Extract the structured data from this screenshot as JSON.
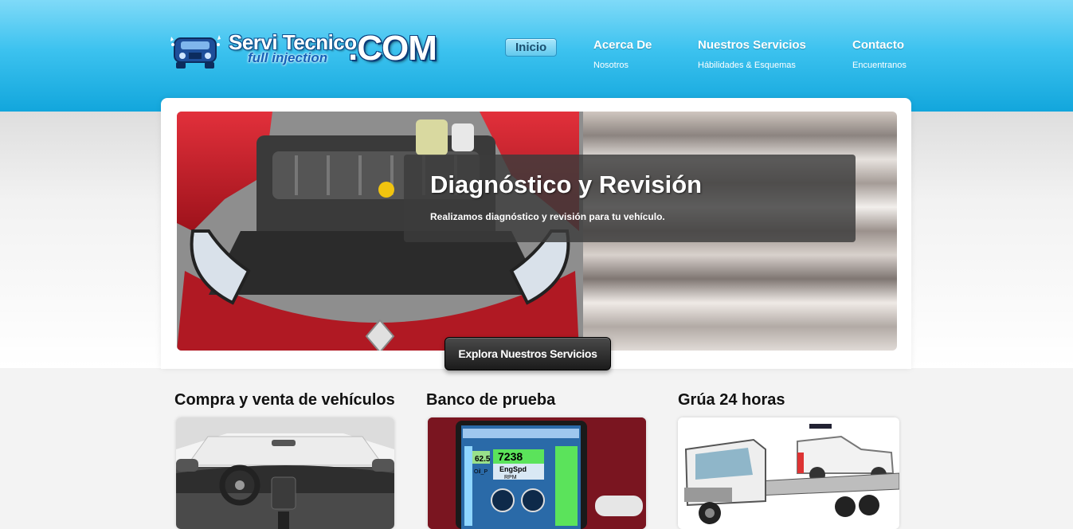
{
  "logo": {
    "line1": "Servi Tecnico",
    "line2": "full injection",
    "line3": ".COM"
  },
  "nav": {
    "items": [
      {
        "label": "Inicio",
        "sub": ""
      },
      {
        "label": "Acerca De",
        "sub": "Nosotros"
      },
      {
        "label": "Nuestros Servicios",
        "sub": "Hábilidades & Esquemas"
      },
      {
        "label": "Contacto",
        "sub": "Encuentranos"
      }
    ]
  },
  "hero": {
    "title": "Diagnóstico y Revisión",
    "text": "Realizamos diagnóstico y revisión para tu vehículo.",
    "button": "Explora Nuestros Servicios"
  },
  "services": [
    {
      "title": "Compra y venta de vehículos"
    },
    {
      "title": "Banco de prueba"
    },
    {
      "title": "Grúa 24 horas"
    }
  ],
  "dashboard": {
    "value1": "62.5",
    "value2": "7238",
    "label1": "EngSpd",
    "label2": "RPM",
    "label3": "Oil_P"
  },
  "colors": {
    "header_top": "#7fdaf8",
    "header_bottom": "#12a6dc",
    "car_red": "#c8202a",
    "button_dark": "#1b1b1b"
  }
}
